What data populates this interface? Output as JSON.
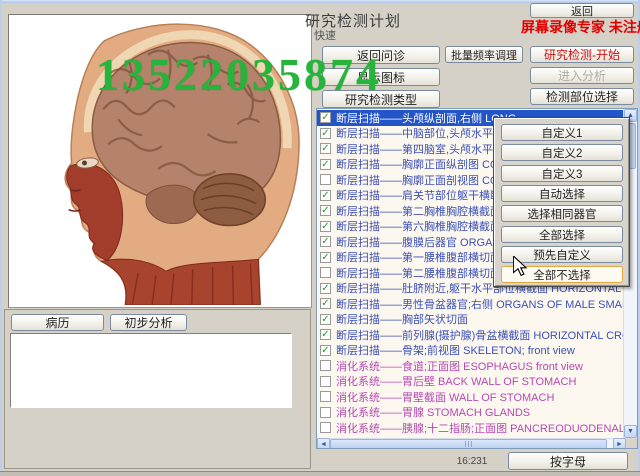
{
  "window": {
    "title": "研究检测计划",
    "subtitle": "快速"
  },
  "overlays": {
    "phone_number": "13522035874",
    "watermark": "屏幕录像专家 未注册"
  },
  "toolbar": {
    "back": "返回",
    "col1": [
      "返回问诊",
      "显示图标",
      "研究检测类型"
    ],
    "col2": [
      "批量频率调理"
    ],
    "col3": [
      {
        "label": "研究检测-开始",
        "variant": "danger"
      },
      {
        "label": "进入分析",
        "variant": "disabled"
      },
      {
        "label": "检测部位选择",
        "variant": "normal"
      }
    ]
  },
  "left_panel": {
    "image_description": "anatomical sagittal head cross-section",
    "medical_record_button": "病历",
    "preliminary_analysis_button": "初步分析",
    "notes_value": ""
  },
  "list": {
    "items": [
      {
        "text": "断层扫描——头颅纵剖面,右侧 LONG",
        "checked": true,
        "selected": true,
        "group": "ct"
      },
      {
        "text": "断层扫描——中脑部位,头颅水平部位",
        "checked": true,
        "selected": false,
        "group": "ct"
      },
      {
        "text": "断层扫描——第四脑室,头颅水平部位",
        "checked": true,
        "selected": false,
        "group": "ct"
      },
      {
        "text": "断层扫描——胸廓正面纵剖图 CORON",
        "checked": true,
        "selected": false,
        "group": "ct"
      },
      {
        "text": "断层扫描——胸廓正面剖视图 CORON",
        "checked": false,
        "selected": false,
        "group": "ct"
      },
      {
        "text": "断层扫描——肩关节部位躯干横断面",
        "checked": true,
        "selected": false,
        "group": "ct"
      },
      {
        "text": "断层扫描——第二胸椎胸腔横截面 LO",
        "checked": true,
        "selected": false,
        "group": "ct"
      },
      {
        "text": "断层扫描——第六胸椎胸腔横截面 HO",
        "checked": true,
        "selected": false,
        "group": "ct"
      },
      {
        "text": "断层扫描——腹膜后器官 ORGANS OF",
        "checked": true,
        "selected": false,
        "group": "ct"
      },
      {
        "text": "断层扫描——第一腰椎腹部横切面 C",
        "checked": true,
        "selected": false,
        "group": "ct"
      },
      {
        "text": "断层扫描——第二腰椎腹部横切面 C",
        "checked": false,
        "selected": false,
        "group": "ct"
      },
      {
        "text": "断层扫描——肚脐附近,躯干水平部位横截面 HORIZONTAL CROSS-SECTI",
        "checked": true,
        "selected": false,
        "group": "ct"
      },
      {
        "text": "断层扫描——男性骨盆器官;右侧 ORGANS OF MALE SMALL PELVIS, right si",
        "checked": true,
        "selected": false,
        "group": "ct"
      },
      {
        "text": "断层扫描——胸部矢状切面",
        "checked": true,
        "selected": false,
        "group": "ct"
      },
      {
        "text": "断层扫描——前列腺(摄护腺)骨盆横截面 HORIZONTAL CROSS-SECTION C",
        "checked": true,
        "selected": false,
        "group": "ct"
      },
      {
        "text": "断层扫描——骨架;前视图 SKELETON;  front  view",
        "checked": true,
        "selected": false,
        "group": "ct"
      },
      {
        "text": "消化系统——食道;正面图 ESOPHAGUS   front  view",
        "checked": false,
        "selected": false,
        "group": "digestive"
      },
      {
        "text": "消化系统——胃后壁 BACK WALL OF STOMACH",
        "checked": false,
        "selected": false,
        "group": "digestive"
      },
      {
        "text": "消化系统——胃壁截面 WALL OF STOMACH",
        "checked": false,
        "selected": false,
        "group": "digestive"
      },
      {
        "text": "消化系统——胃腺 STOMACH  GLANDS",
        "checked": false,
        "selected": false,
        "group": "digestive"
      },
      {
        "text": "消化系统——胰腺;十二指肠;正面图 PANCREODUODENAL  ZONE;  front  vie",
        "checked": false,
        "selected": false,
        "group": "digestive"
      }
    ]
  },
  "popup": {
    "buttons": [
      "自定义1",
      "自定义2",
      "自定义3",
      "自动选择",
      "选择相同器官",
      "全部选择",
      "预先自定义",
      "全部不选择"
    ],
    "active": "全部不选择"
  },
  "statusbar": {
    "counter": "16:231",
    "alpha_sort_button": "按字母"
  },
  "colors": {
    "ct_item": "#3b50b8",
    "digestive_item": "#b44ab4",
    "selection_bg": "#2455c8",
    "danger_text": "#cc1111",
    "watermark": "#e00000",
    "phone": "#28b43c",
    "active_popup_border": "#e7a53e"
  }
}
